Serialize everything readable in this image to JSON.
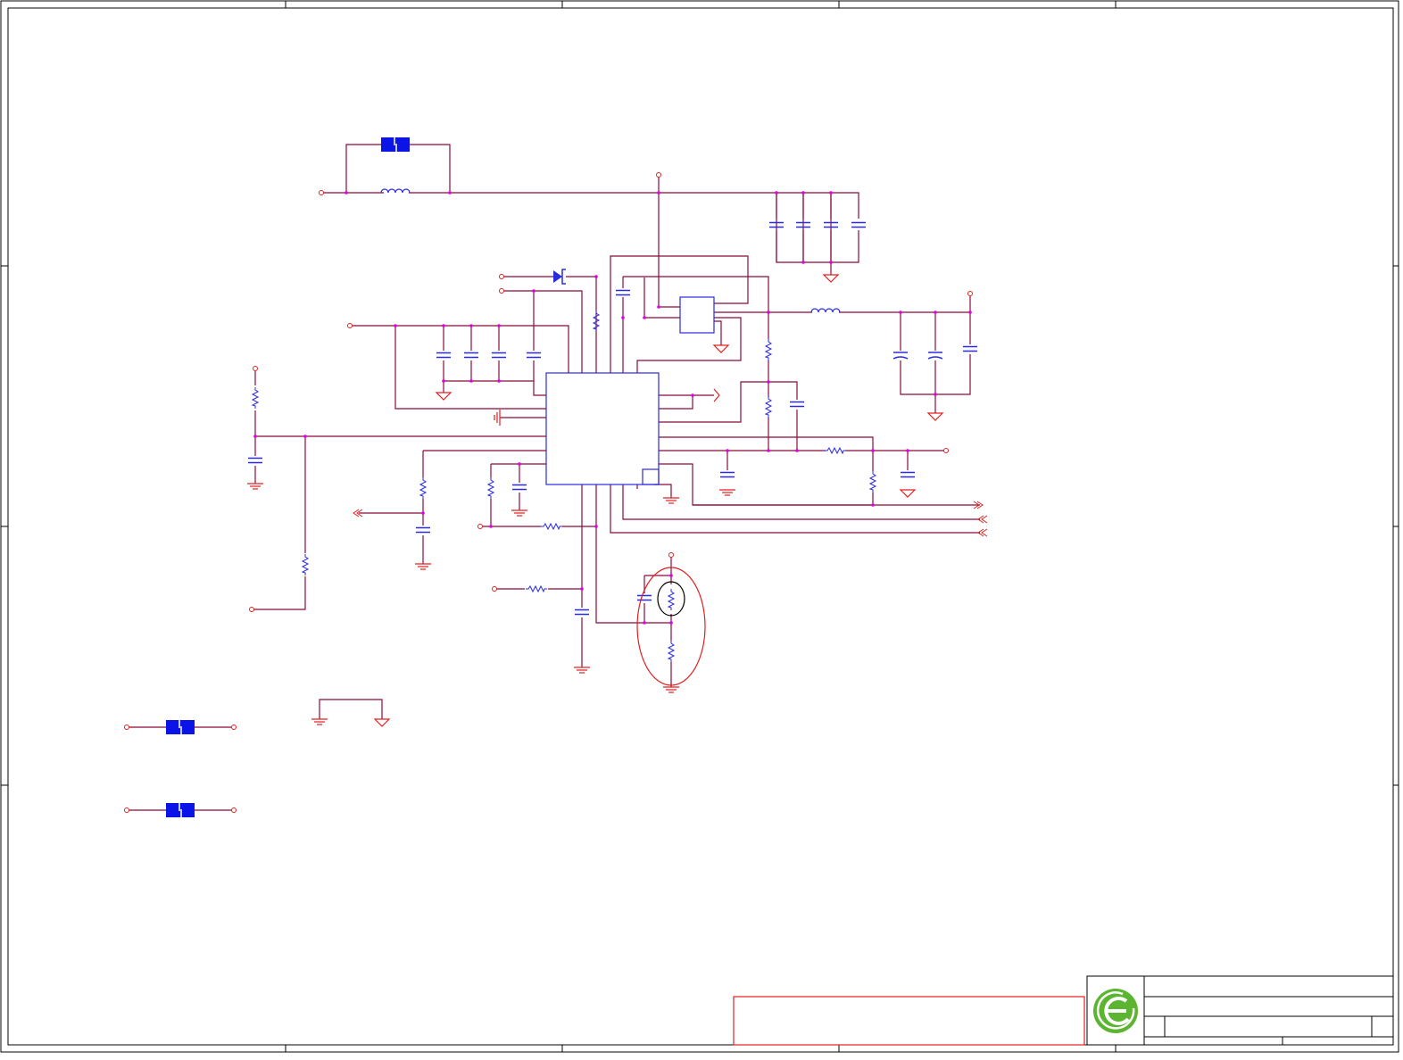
{
  "colors": {
    "wire": "#8b0a3c",
    "component": "#2a2ae0",
    "power": "#e02020",
    "junction": "#e000e0",
    "border": "#000000",
    "logo": "#5cb531",
    "jumper_fill": "#0a14e6",
    "note_box": "#e02020"
  },
  "icons": [
    "inductor-icon",
    "capacitor-icon",
    "resistor-icon",
    "diode-icon",
    "ground-icon",
    "jumper-icon",
    "logo-icon"
  ],
  "title_block": {
    "logo": "logo-icon"
  }
}
